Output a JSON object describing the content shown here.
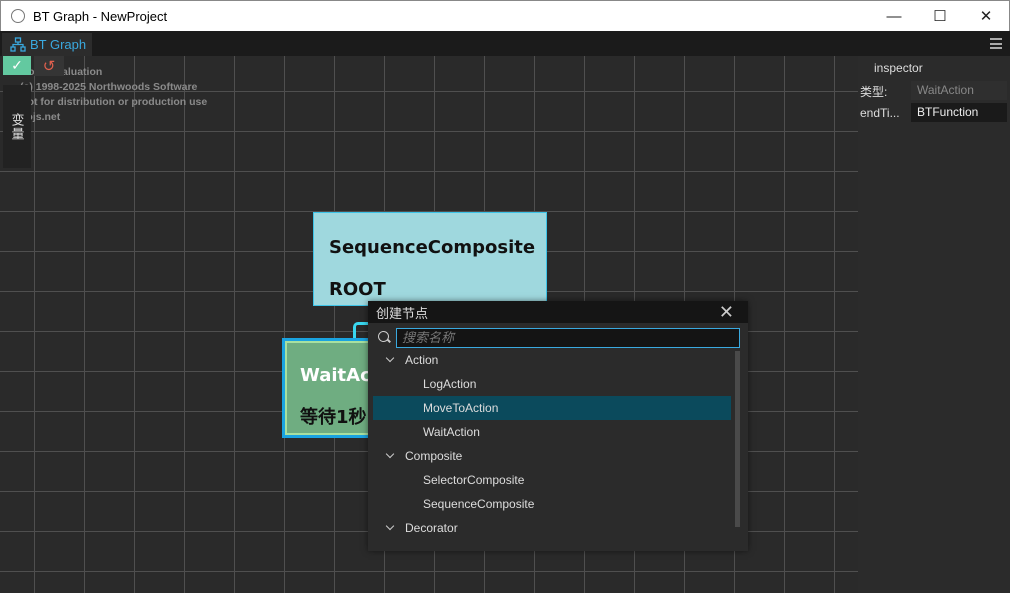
{
  "window": {
    "title": "BT Graph - NewProject",
    "minimize": "—",
    "maximize": "☐",
    "close": "✕"
  },
  "tab": {
    "label": "BT Graph"
  },
  "watermark": [
    "GoJS evaluation",
    "(c) 1998-2025 Northwoods Software",
    "Not for distribution or production use",
    "gojs.net"
  ],
  "toolbar": {
    "ok": "✓",
    "reset": "↺",
    "variables": "变量"
  },
  "nodes": {
    "root": {
      "type": "SequenceComposite",
      "name": "ROOT"
    },
    "wait": {
      "type": "WaitAction",
      "name": "等待1秒"
    }
  },
  "dialog": {
    "title": "创建节点",
    "close": "✕",
    "search_placeholder": "搜索名称",
    "items": [
      {
        "label": "Action",
        "kind": "category"
      },
      {
        "label": "LogAction",
        "kind": "leaf"
      },
      {
        "label": "MoveToAction",
        "kind": "leaf",
        "selected": true
      },
      {
        "label": "WaitAction",
        "kind": "leaf"
      },
      {
        "label": "Composite",
        "kind": "category"
      },
      {
        "label": "SelectorComposite",
        "kind": "leaf"
      },
      {
        "label": "SequenceComposite",
        "kind": "leaf"
      },
      {
        "label": "Decorator",
        "kind": "category"
      }
    ]
  },
  "inspector": {
    "title": "inspector",
    "type_label": "类型:",
    "type_value": "WaitAction",
    "field_label": "endTi...",
    "field_value": "BTFunction"
  }
}
